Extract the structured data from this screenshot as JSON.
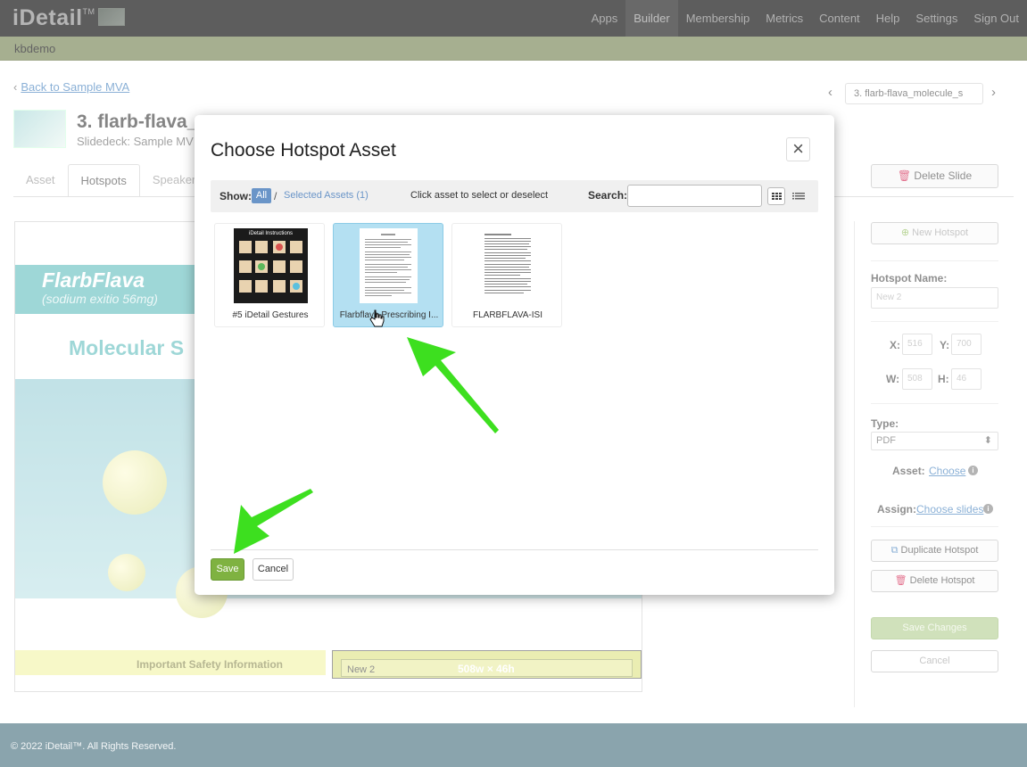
{
  "app": {
    "logo": "iDetail",
    "logo_tm": "TM",
    "nav": [
      "Apps",
      "Builder",
      "Membership",
      "Metrics",
      "Content",
      "Help",
      "Settings",
      "Sign Out"
    ],
    "active_nav": "Builder",
    "account": "kbdemo"
  },
  "page": {
    "back_link": "Back to Sample MVA",
    "slide_title": "3. flarb-flava_",
    "slidedeck": "Slidedeck: Sample MV",
    "pager_value": "3. flarb-flava_molecule_s",
    "tabs": [
      "Asset",
      "Hotspots",
      "Speaker N"
    ],
    "active_tab": "Hotspots",
    "delete_slide": "Delete Slide"
  },
  "slide_preview": {
    "brand": "FlarbFlava",
    "brand_sub": "(sodium exitio 56mg)",
    "heading": "Molecular S",
    "safety": "Important Safety Information",
    "hotspot_name": "New 2",
    "hotspot_dims": "508w × 46h"
  },
  "right_panel": {
    "new_hotspot": "New Hotspot",
    "hotspot_name_label": "Hotspot Name:",
    "hotspot_name_value": "New 2",
    "x_label": "X:",
    "x_value": "516",
    "y_label": "Y:",
    "y_value": "700",
    "w_label": "W:",
    "w_value": "508",
    "h_label": "H:",
    "h_value": "46",
    "type_label": "Type:",
    "type_value": "PDF",
    "asset_label": "Asset:",
    "asset_link": "Choose",
    "assign_label": "Assign:",
    "assign_link": "Choose slides",
    "duplicate": "Duplicate Hotspot",
    "delete": "Delete Hotspot",
    "save_changes": "Save Changes",
    "cancel": "Cancel"
  },
  "footer": "© 2022 iDetail™.  All Rights Reserved.",
  "modal": {
    "title": "Choose Hotspot Asset",
    "show_label": "Show:",
    "show_all": "All",
    "slash": "/",
    "selected_assets": "Selected Assets (1)",
    "hint": "Click asset to select or deselect",
    "search_label": "Search:",
    "search_value": "",
    "assets": [
      {
        "name": "#5 iDetail Gestures",
        "selected": false,
        "thumb_title": "iDetail Instructions"
      },
      {
        "name": "Flarbflava Prescribing I...",
        "selected": true
      },
      {
        "name": "FLARBFLAVA-ISI",
        "selected": false
      }
    ],
    "save": "Save",
    "cancel": "Cancel"
  },
  "colors": {
    "accent_green": "#7fb241",
    "nav_bg": "#111111",
    "subbar": "#c4d98e",
    "selected_asset": "#b4e0f2",
    "link": "#2a6fb5",
    "annotation_arrow": "#3ddf1f"
  }
}
